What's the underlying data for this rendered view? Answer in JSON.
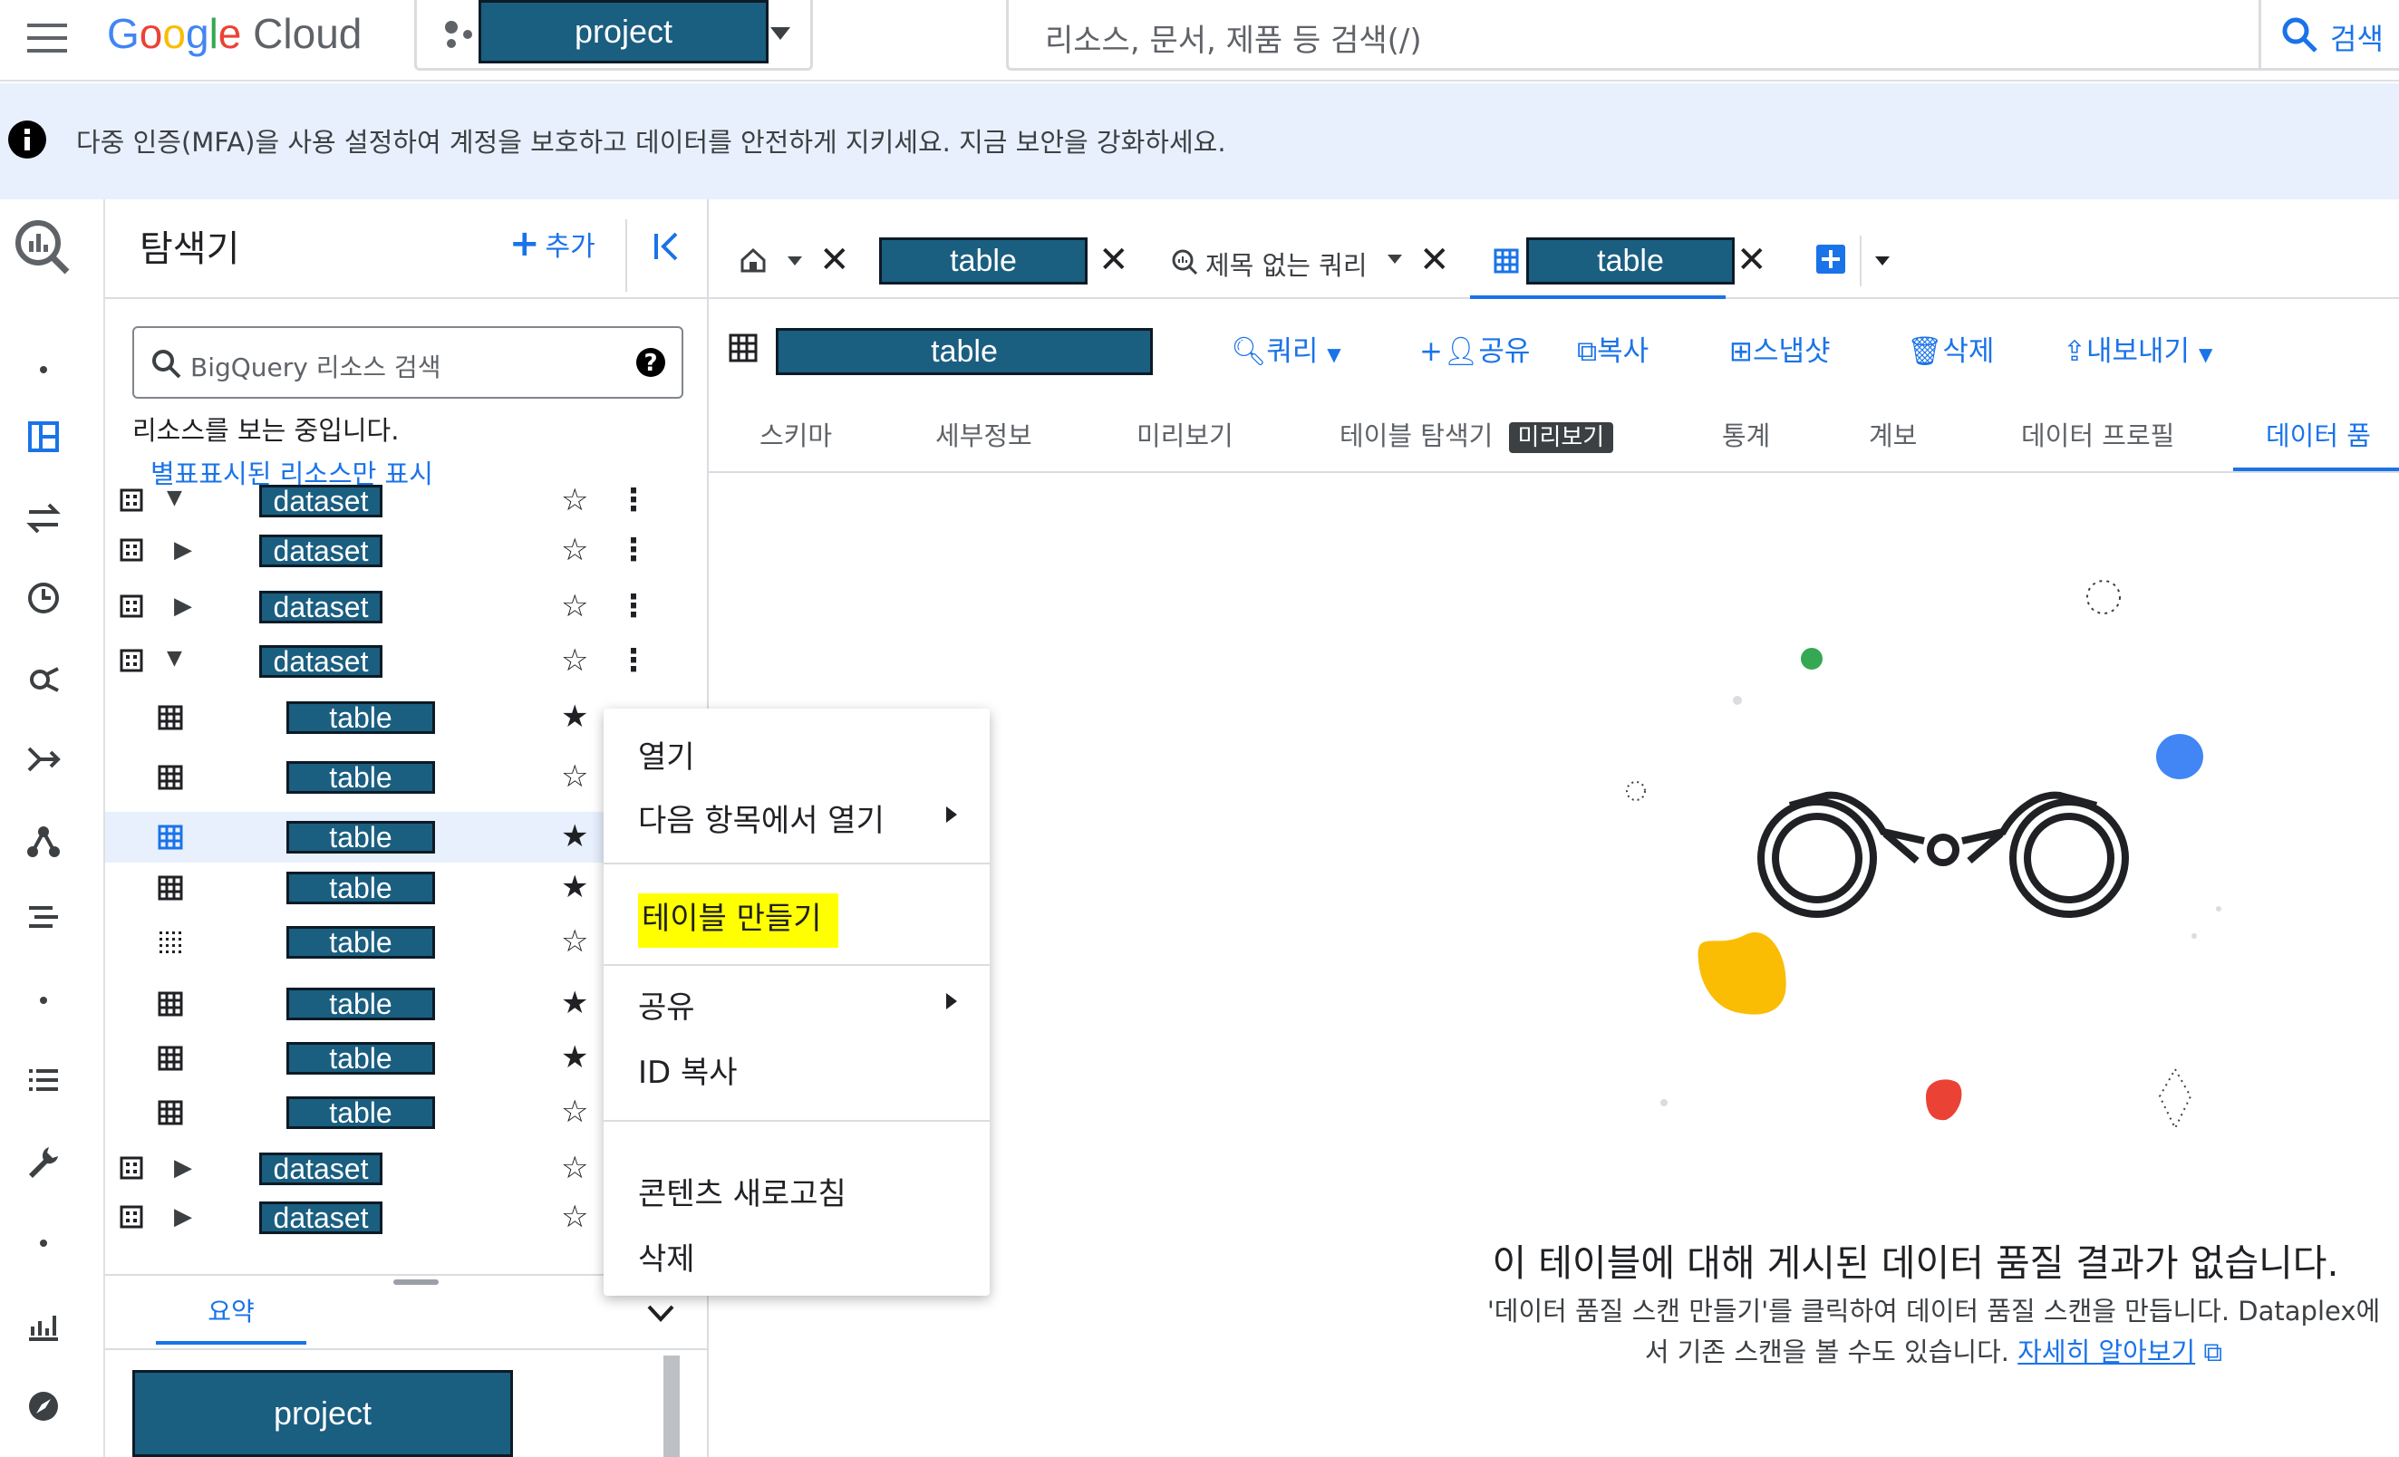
{
  "topbar": {
    "logo": "Google Cloud",
    "project": "project",
    "search_placeholder": "리소스, 문서, 제품 등 검색(/)",
    "search_button": "검색"
  },
  "banner": {
    "text": "다중 인증(MFA)을 사용 설정하여 계정을 보호하고 데이터를 안전하게 지키세요. 지금 보안을 강화하세요."
  },
  "explorer": {
    "title": "탐색기",
    "add_label": "추가",
    "search_placeholder": "BigQuery 리소스 검색",
    "viewing_text": "리소스를 보는 중입니다.",
    "starred_link": "별표표시된 리소스만 표시",
    "rows": [
      {
        "label": "dataset",
        "kind": "dataset",
        "state": "expanded",
        "starred": false
      },
      {
        "label": "dataset",
        "kind": "dataset",
        "state": "collapsed",
        "starred": false
      },
      {
        "label": "dataset",
        "kind": "dataset",
        "state": "collapsed",
        "starred": false
      },
      {
        "label": "dataset",
        "kind": "dataset",
        "state": "expanded",
        "starred": false
      },
      {
        "label": "table",
        "kind": "table",
        "starred": true
      },
      {
        "label": "table",
        "kind": "table",
        "starred": false
      },
      {
        "label": "table",
        "kind": "table",
        "starred": true,
        "selected": true
      },
      {
        "label": "table",
        "kind": "table",
        "starred": true
      },
      {
        "label": "table",
        "kind": "view",
        "starred": false
      },
      {
        "label": "table",
        "kind": "table",
        "starred": true
      },
      {
        "label": "table",
        "kind": "table",
        "starred": true
      },
      {
        "label": "table",
        "kind": "table",
        "starred": false
      },
      {
        "label": "dataset",
        "kind": "dataset",
        "state": "collapsed",
        "starred": false
      },
      {
        "label": "dataset",
        "kind": "dataset",
        "state": "collapsed",
        "starred": false
      }
    ],
    "bottom_tab": "요약",
    "bottom_project": "project"
  },
  "context_menu": {
    "items": [
      {
        "label": "열기",
        "submenu": false
      },
      {
        "label": "다음 항목에서 열기",
        "submenu": true
      },
      {
        "label": "테이블 만들기",
        "submenu": false,
        "highlighted": true
      },
      {
        "label": "공유",
        "submenu": true
      },
      {
        "label": "ID 복사",
        "submenu": false
      },
      {
        "label": "콘텐츠 새로고침",
        "submenu": false
      },
      {
        "label": "삭제",
        "submenu": false
      }
    ]
  },
  "tabs": {
    "items": [
      {
        "label": "table",
        "kind": "redacted"
      },
      {
        "label": "제목 없는 쿼리",
        "kind": "query"
      },
      {
        "label": "table",
        "kind": "redacted",
        "active": true
      }
    ]
  },
  "toolbar": {
    "table_name": "table",
    "query": "쿼리",
    "share": "공유",
    "copy": "복사",
    "snapshot": "스냅샷",
    "delete": "삭제",
    "export": "내보내기"
  },
  "subtabs": {
    "items": [
      "스키마",
      "세부정보",
      "미리보기",
      "테이블 탐색기",
      "통계",
      "계보",
      "데이터 프로필",
      "데이터 품"
    ],
    "badge": "미리보기",
    "active_index": 7
  },
  "empty_state": {
    "title": "이 테이블에 대해 게시된 데이터 품질 결과가 없습니다.",
    "desc_line1": "'데이터 품질 스캔 만들기'를 클릭하여 데이터 품질 스캔을 만듭니다. Dataplex에",
    "desc_line2": "서 기존 스캔을 볼 수도 있습니다.",
    "link": "자세히 알아보기"
  },
  "colors": {
    "accent": "#1a73e8",
    "redaction": "#1a5e80",
    "banner": "#e8f0fe",
    "highlight": "#ffff00",
    "dot_green": "#34a853",
    "dot_blue": "#4285f4",
    "dot_yellow": "#fbbc04",
    "dot_red": "#ea4335"
  }
}
